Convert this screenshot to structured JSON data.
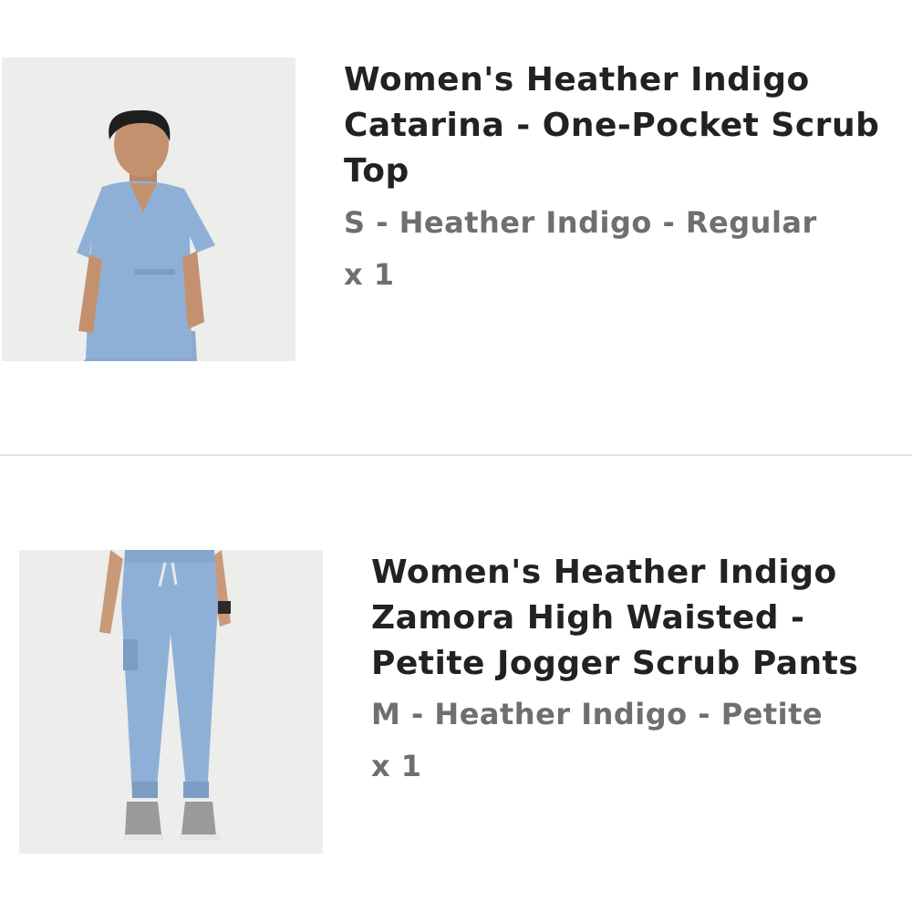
{
  "cart": {
    "items": [
      {
        "title": "Women's Heather Indigo Catarina - One-Pocket Scrub Top",
        "variant": "S - Heather Indigo - Regular",
        "quantity": "x 1",
        "image_icon": "scrub-top-photo"
      },
      {
        "title": "Women's Heather Indigo Zamora High Waisted - Petite Jogger Scrub Pants",
        "variant": "M - Heather Indigo - Petite",
        "quantity": "x 1",
        "image_icon": "jogger-pants-photo"
      }
    ]
  },
  "colors": {
    "scrub_blue": "#8fb0d6",
    "title_text": "#222222",
    "secondary_text": "#6f6f6f",
    "divider": "#e2e2e2",
    "photo_background": "#ededeb"
  }
}
